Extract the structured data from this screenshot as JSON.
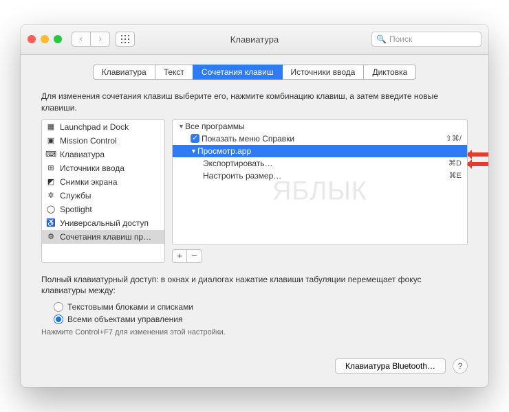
{
  "window": {
    "title": "Клавиатура"
  },
  "search": {
    "placeholder": "Поиск"
  },
  "tabs": [
    "Клавиатура",
    "Текст",
    "Сочетания клавиш",
    "Источники ввода",
    "Диктовка"
  ],
  "active_tab": 2,
  "instruction": "Для изменения сочетания клавиш выберите его, нажмите комбинацию клавиш, а затем введите новые клавиши.",
  "sidebar": [
    {
      "icon": "launchpad",
      "label": "Launchpad и Dock"
    },
    {
      "icon": "mission",
      "label": "Mission Control"
    },
    {
      "icon": "keyboard",
      "label": "Клавиатура"
    },
    {
      "icon": "input",
      "label": "Источники ввода"
    },
    {
      "icon": "screenshot",
      "label": "Снимки экрана"
    },
    {
      "icon": "services",
      "label": "Службы"
    },
    {
      "icon": "spotlight",
      "label": "Spotlight"
    },
    {
      "icon": "accessibility",
      "label": "Универсальный доступ"
    },
    {
      "icon": "app-shortcuts",
      "label": "Сочетания клавиш пр…"
    }
  ],
  "sidebar_sel": 8,
  "right": {
    "root": "Все программы",
    "root_item": {
      "label": "Показать меню Справки",
      "shortcut": "⇧⌘/",
      "checked": true
    },
    "app": "Просмотр.app",
    "items": [
      {
        "label": "Экспортировать…",
        "shortcut": "⌘D"
      },
      {
        "label": "Настроить размер…",
        "shortcut": "⌘E"
      }
    ]
  },
  "add": "+",
  "remove": "−",
  "fka_note": "Полный клавиатурный доступ: в окнах и диалогах нажатие клавиши табуляции перемещает фокус клавиатуры между:",
  "radios": [
    {
      "label": "Текстовыми блоками и списками",
      "on": false
    },
    {
      "label": "Всеми объектами управления",
      "on": true
    }
  ],
  "hint": "Нажмите Control+F7 для изменения этой настройки.",
  "footer": {
    "bluetooth": "Клавиатура Bluetooth…",
    "help": "?"
  },
  "watermark": "ЯБЛЫК"
}
